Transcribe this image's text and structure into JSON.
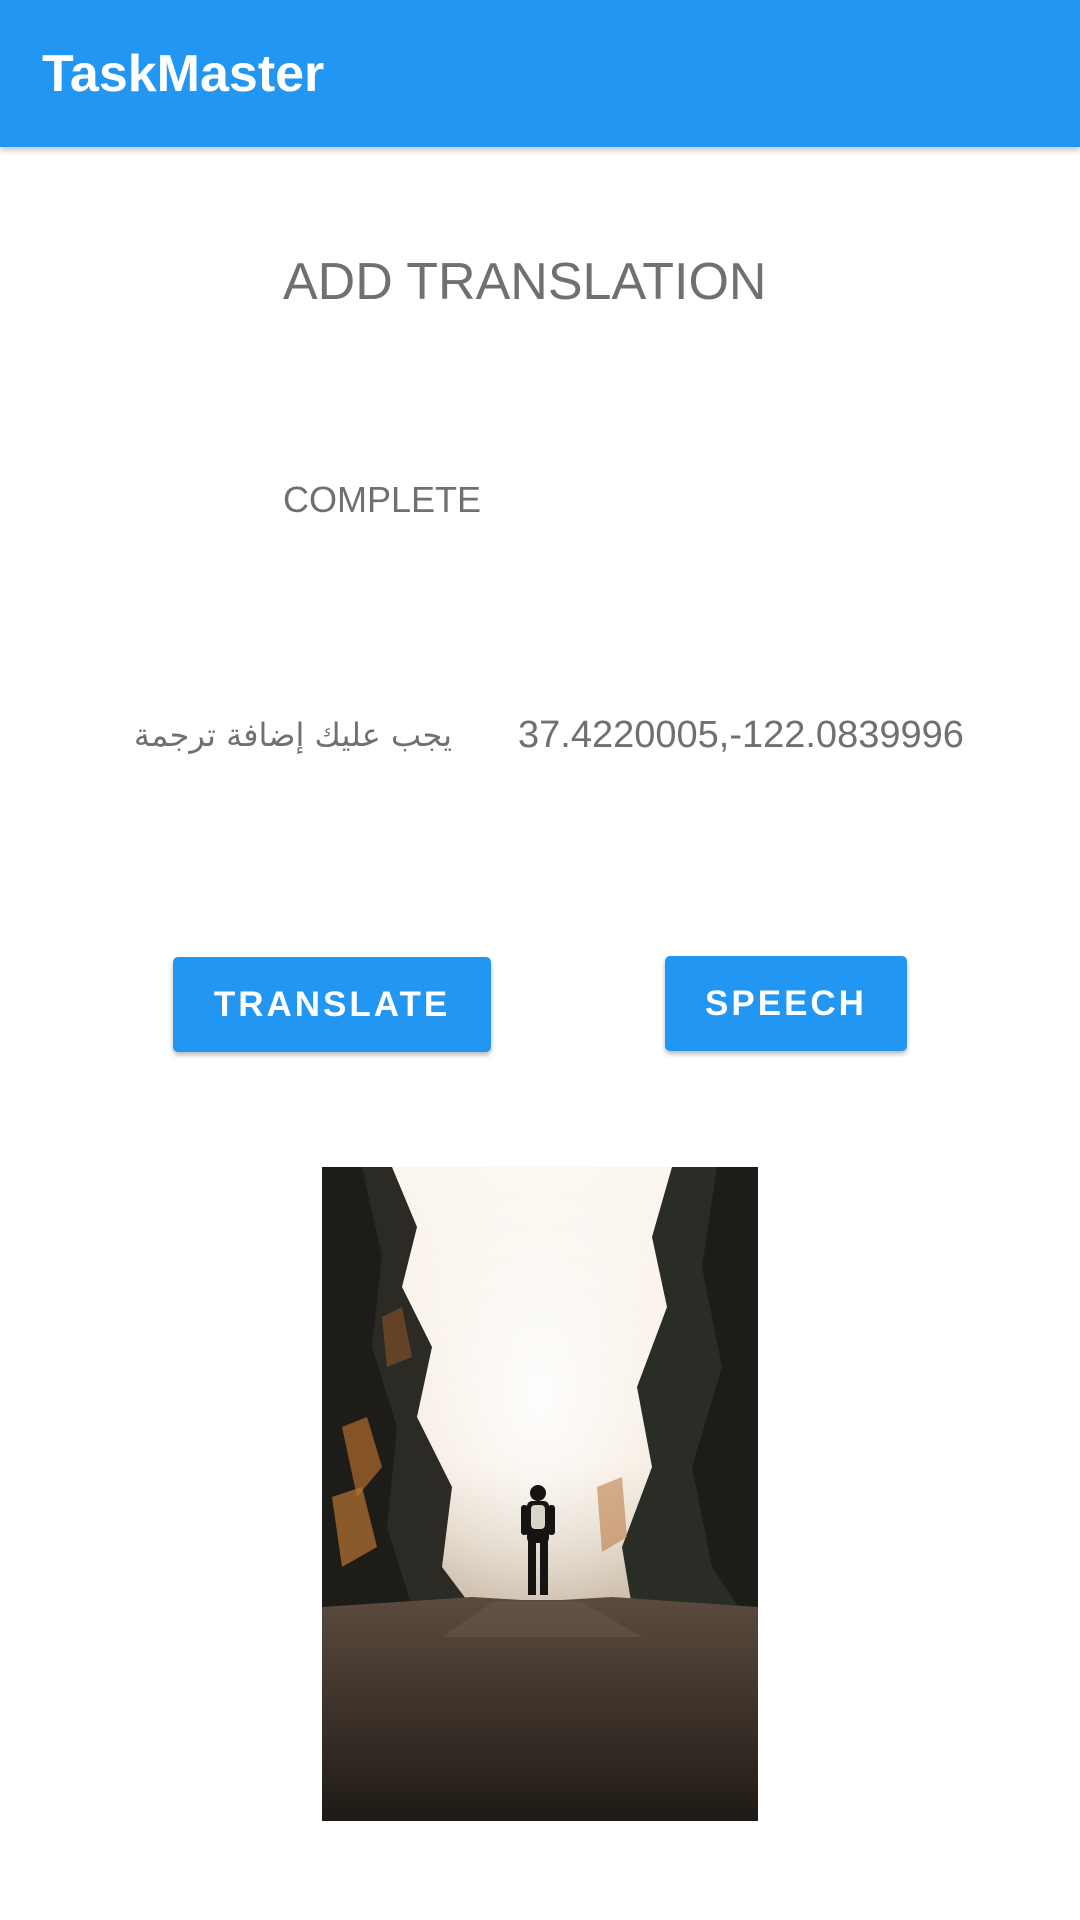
{
  "app_bar": {
    "title": "TaskMaster",
    "color": "#2196F3"
  },
  "main": {
    "heading": "ADD TRANSLATION",
    "status": "COMPLETE",
    "message_arabic": "يجب عليك إضافة ترجمة",
    "location": "37.4220005,-122.0839996"
  },
  "buttons": {
    "translate_label": "TRANSLATE",
    "speech_label": "SPEECH"
  },
  "image": {
    "alt": "photo"
  }
}
